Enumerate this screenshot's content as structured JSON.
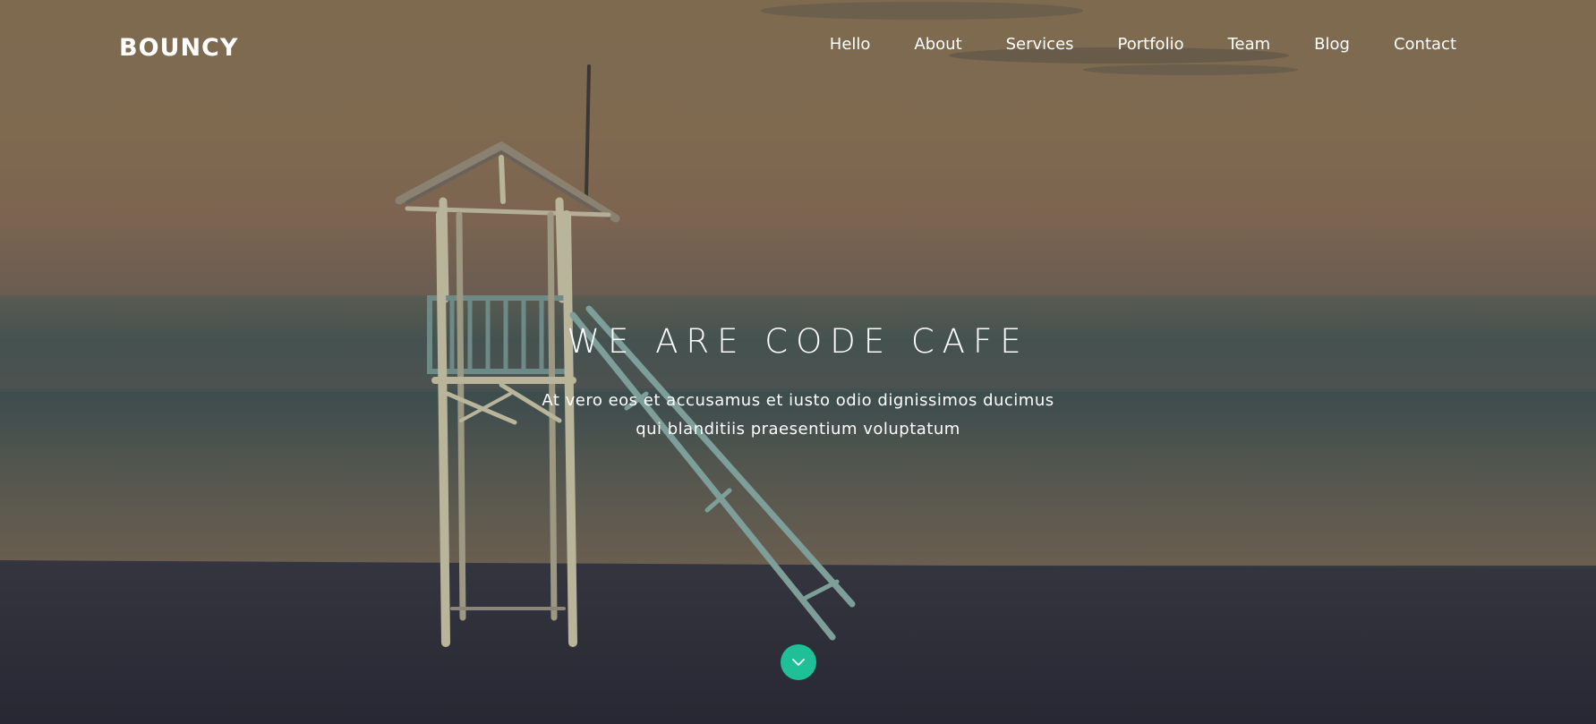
{
  "brand": {
    "logo_text": "BOUNCY"
  },
  "nav": {
    "items": [
      {
        "label": "Hello"
      },
      {
        "label": "About"
      },
      {
        "label": "Services"
      },
      {
        "label": "Portfolio"
      },
      {
        "label": "Team"
      },
      {
        "label": "Blog"
      },
      {
        "label": "Contact"
      }
    ]
  },
  "hero": {
    "title": "WE ARE CODE CAFE",
    "subtitle": "At vero eos et accusamus et iusto odio dignissimos ducimus qui blanditiis praesentium voluptatum",
    "scroll_icon": "chevron-down-icon",
    "background_image": "lifeguard-tower-on-beach-photo"
  },
  "colors": {
    "accent": "#1fbf98",
    "text": "#ffffff",
    "sand": "#2a2b35"
  }
}
